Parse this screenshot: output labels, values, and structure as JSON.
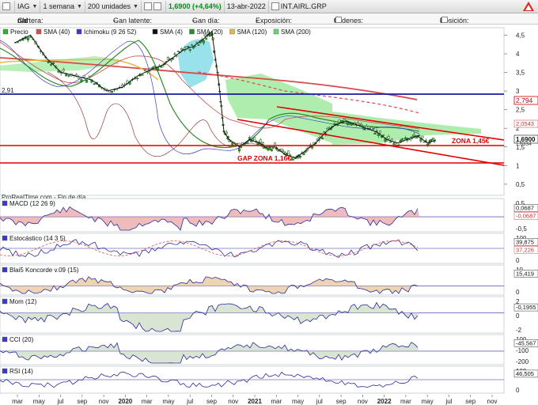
{
  "toolbar": {
    "symbol": "IAG",
    "period": "1 semana",
    "units": "200 unidades",
    "price": "1,6900 (+4,64%)",
    "date": "13-abr-2022",
    "name": "INT.AIRL.GRP"
  },
  "infobar": {
    "cartera_label": "Cartera:",
    "cartera_value": "n/d",
    "latente_label": "Gan latente:",
    "latente_value": "-",
    "dia_label": "Gan día:",
    "dia_value": "-",
    "exposicion_label": "Exposición:",
    "exposicion_value": "-",
    "ordenes_label": "Órdenes:",
    "ordenes_value1": "0",
    "ordenes_value2": "0",
    "posicion_label": "Posición:",
    "posicion_value": "0"
  },
  "colors": {
    "price": "#1a7a1a",
    "sma40": "#c23c3c",
    "sma20": "#2a8a2a",
    "sma120": "#e0b030",
    "sma4": "#111111",
    "zone": "#e00000",
    "level": "#1a1aa0",
    "cloud": "#8fe38f"
  },
  "chart_data": [
    {
      "type": "line",
      "name": "main",
      "legend": [
        "Precio",
        "SMA (40)",
        "Ichimoku (9 26 52)",
        "SMA (4)",
        "SMA (20)",
        "SMA (120)",
        "SMA (200)"
      ],
      "ylim": [
        0.2,
        4.7
      ],
      "yticks": [
        "4,5",
        "4",
        "3,5",
        "3",
        "2,5",
        "2",
        "1,5",
        "1",
        "0,5"
      ],
      "ytick_values": [
        4.5,
        4.0,
        3.5,
        3.0,
        2.5,
        2.0,
        1.5,
        1.0,
        0.5
      ],
      "price_labels": [
        "2,794",
        "2,0543",
        "1,6900",
        "1,6334"
      ],
      "left_label": "2,91",
      "source_label": "ProRealTime.com - Fin de día",
      "annotations": [
        "ZONA 1,45€",
        "GAP ZONA 1,16€"
      ],
      "x": [
        2018.15,
        2018.3,
        2018.45,
        2018.6,
        2018.75,
        2018.9,
        2019.05,
        2019.2,
        2019.35,
        2019.5,
        2019.6,
        2019.7,
        2019.8,
        2019.9,
        2020.0,
        2020.08,
        2020.15,
        2020.2,
        2020.25,
        2020.35,
        2020.45,
        2020.55,
        2020.6,
        2020.7,
        2020.8,
        2020.9,
        2021.0,
        2021.1,
        2021.2,
        2021.3,
        2021.4,
        2021.5,
        2021.6,
        2021.7,
        2021.8,
        2021.9,
        2022.0,
        2022.1,
        2022.2,
        2022.28
      ],
      "price": [
        4.3,
        4.5,
        3.9,
        3.5,
        3.4,
        3.3,
        3.0,
        3.1,
        3.4,
        3.6,
        3.7,
        3.9,
        4.1,
        4.2,
        4.4,
        4.6,
        3.2,
        1.9,
        1.7,
        1.5,
        1.7,
        1.6,
        1.5,
        1.5,
        1.3,
        1.2,
        1.4,
        1.6,
        1.9,
        2.1,
        2.2,
        2.1,
        2.0,
        1.9,
        1.7,
        1.6,
        1.7,
        1.8,
        1.6,
        1.69
      ]
    },
    {
      "type": "line",
      "name": "macd",
      "legend": [
        "MACD (12 26 9)"
      ],
      "price_labels": [
        "0,0687",
        "-0,0687"
      ],
      "yticks": [
        "0,5",
        "0",
        "-0,5"
      ]
    },
    {
      "type": "line",
      "name": "stochastic",
      "legend": [
        "Estocástico (14 3 5)"
      ],
      "price_labels": [
        "39,875",
        "37,226"
      ],
      "yticks": [
        "100",
        "0"
      ]
    },
    {
      "type": "area",
      "name": "koncorde",
      "legend": [
        "Blai5 Koncorde v.09 (15)"
      ],
      "price_labels": [
        "15,419"
      ],
      "yticks": [
        "10",
        "0"
      ]
    },
    {
      "type": "line",
      "name": "momentum",
      "legend": [
        "Mom (12)"
      ],
      "price_labels": [
        "-0,1955"
      ],
      "yticks": [
        "2",
        "0",
        "-2"
      ]
    },
    {
      "type": "line",
      "name": "cci",
      "legend": [
        "CCI (20)"
      ],
      "price_labels": [
        "-45,567"
      ],
      "yticks": [
        "100",
        "-100",
        "-200"
      ]
    },
    {
      "type": "line",
      "name": "rsi",
      "legend": [
        "RSI (14)"
      ],
      "price_labels": [
        "46,505"
      ],
      "yticks": [
        "100",
        "0"
      ]
    }
  ],
  "xaxis": {
    "labels": [
      "mar",
      "may",
      "jul",
      "sep",
      "nov",
      "2020",
      "mar",
      "may",
      "jul",
      "sep",
      "nov",
      "2021",
      "mar",
      "may",
      "jul",
      "sep",
      "nov",
      "2022",
      "mar",
      "may",
      "jul",
      "sep",
      "nov"
    ],
    "bold": [
      false,
      false,
      false,
      false,
      false,
      true,
      false,
      false,
      false,
      false,
      false,
      true,
      false,
      false,
      false,
      false,
      false,
      true,
      false,
      false,
      false,
      false,
      false
    ]
  }
}
